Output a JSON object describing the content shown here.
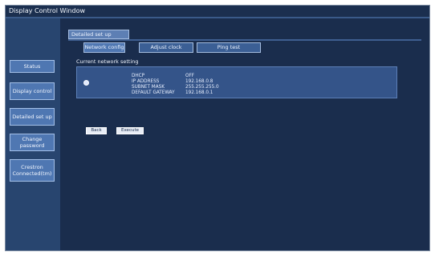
{
  "window": {
    "title": "Display Control Window"
  },
  "sidebar": {
    "items": [
      {
        "label": "Status"
      },
      {
        "label": "Display control"
      },
      {
        "label": "Detailed set up"
      },
      {
        "label": "Change password"
      },
      {
        "label": "Crestron Connected(tm)"
      }
    ]
  },
  "main": {
    "section_title": "Detailed set up",
    "tabs": [
      {
        "label": "Network config",
        "active": true
      },
      {
        "label": "Adjust clock",
        "active": false
      },
      {
        "label": "Ping test",
        "active": false
      }
    ],
    "network_settings": {
      "title": "Current network setting",
      "rows": [
        {
          "label": "DHCP",
          "value": "OFF"
        },
        {
          "label": "IP ADDRESS",
          "value": "192.168.0.8"
        },
        {
          "label": "SUBNET MASK",
          "value": "255.255.255.0"
        },
        {
          "label": "DEFAULT GATEWAY",
          "value": "192.168.0.1"
        }
      ]
    },
    "buttons": {
      "back": "Back",
      "execute": "Execute"
    }
  },
  "colors": {
    "frame_bg": "#1b2f4f",
    "sidebar_bg": "#28456f",
    "main_bg": "#1a2d4d",
    "button_bg": "#4f77b2",
    "panel_bg": "#345489",
    "text": "#f3f7ff"
  }
}
